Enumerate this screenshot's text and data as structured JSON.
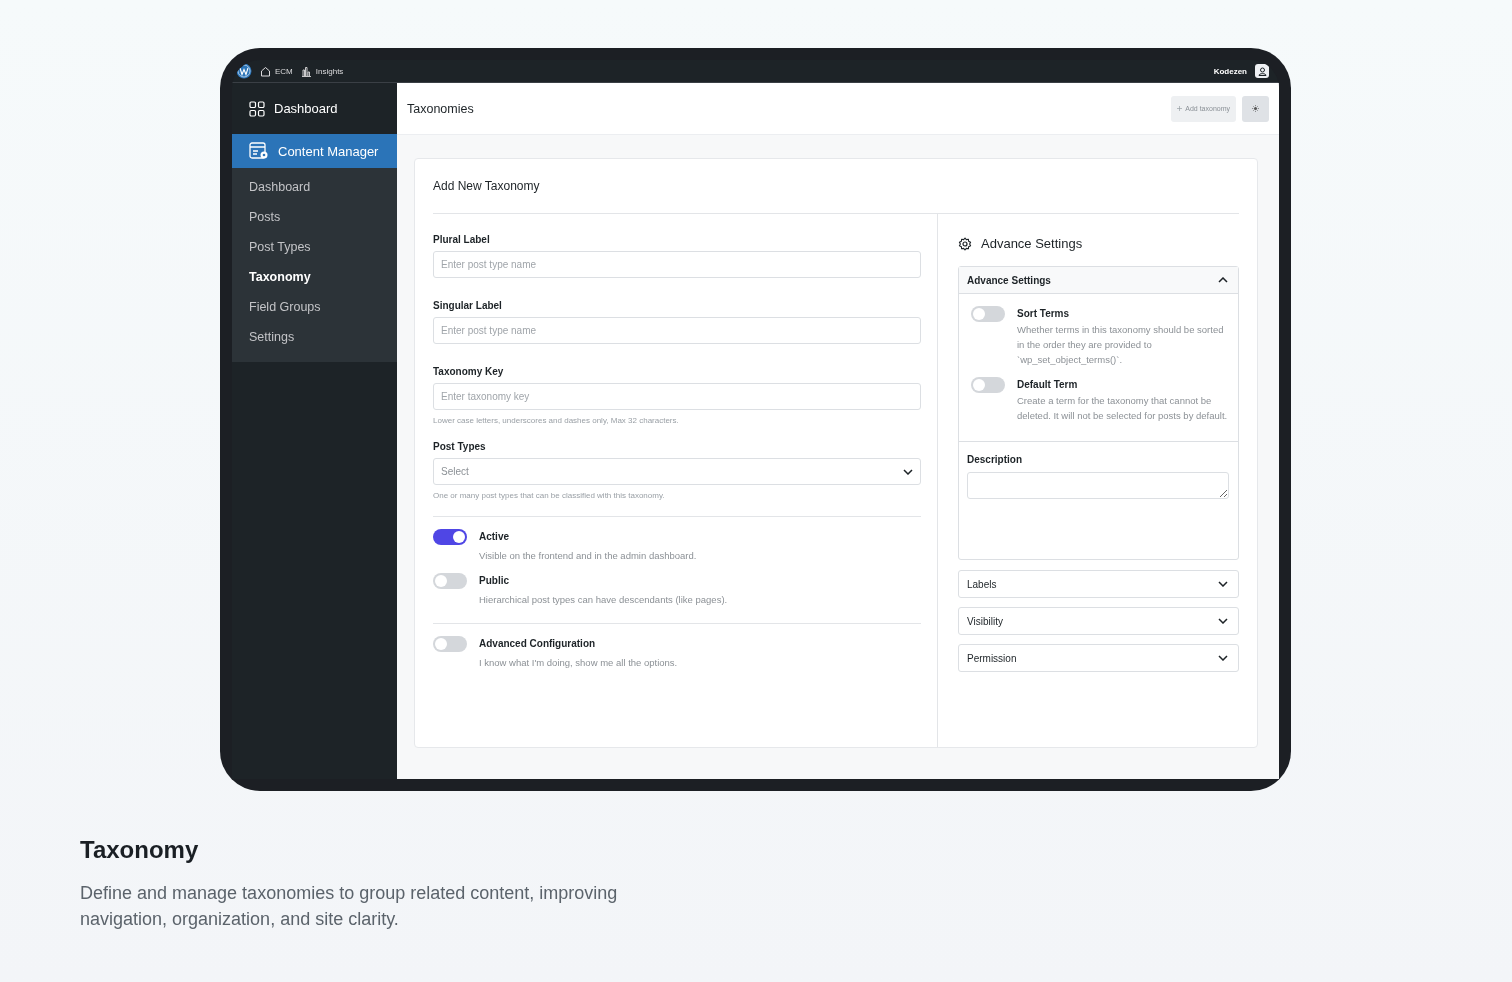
{
  "topbar": {
    "items": [
      {
        "kind": "home",
        "label": "ECM"
      },
      {
        "kind": "chart",
        "label": "Insights"
      }
    ],
    "user": "Kodezen"
  },
  "sidebar": {
    "header": "Dashboard",
    "section": {
      "label": "Content Manager",
      "selected": true
    },
    "items": [
      {
        "label": "Dashboard",
        "selected": false
      },
      {
        "label": "Posts",
        "selected": false
      },
      {
        "label": "Post Types",
        "selected": false
      },
      {
        "label": "Taxonomy",
        "selected": true
      },
      {
        "label": "Field Groups",
        "selected": false
      },
      {
        "label": "Settings",
        "selected": false
      }
    ]
  },
  "page": {
    "title": "Taxonomies",
    "add_button": "Add taxonomy"
  },
  "form": {
    "title": "Add New Taxonomy",
    "fields": [
      {
        "kind": "text",
        "label": "Plural Label",
        "placeholder": "Enter post type name"
      },
      {
        "kind": "text",
        "label": "Singular Label",
        "placeholder": "Enter post type name"
      },
      {
        "kind": "text",
        "label": "Taxonomy Key",
        "placeholder": "Enter taxonomy key",
        "help": "Lower case letters, underscores and dashes only, Max 32 characters."
      },
      {
        "kind": "select",
        "label": "Post Types",
        "placeholder": "Select",
        "help": "One or many post types that can be classified with this taxonomy."
      }
    ],
    "toggle_groups": [
      [
        {
          "title": "Active",
          "description": "Visible on the frontend and in the admin dashboard.",
          "on": true
        },
        {
          "title": "Public",
          "description": "Hierarchical post types can have descendants (like pages).",
          "on": false
        }
      ],
      [
        {
          "title": "Advanced Configuration",
          "description": "I know what I'm doing, show me all the options.",
          "on": false
        }
      ]
    ]
  },
  "advanced": {
    "title": "Advance Settings",
    "panel": {
      "title": "Advance Settings",
      "expanded": true,
      "toggles": [
        {
          "title": "Sort Terms",
          "description": "Whether terms in this taxonomy should be sorted in the order they are provided to `wp_set_object_terms()`.",
          "on": false
        },
        {
          "title": "Default Term",
          "description": "Create a term for the taxonomy that cannot be deleted. It will not be selected for posts by default.",
          "on": false
        }
      ],
      "description_label": "Description"
    },
    "sections": [
      {
        "label": "Labels",
        "expanded": false
      },
      {
        "label": "Visibility",
        "expanded": false
      },
      {
        "label": "Permission",
        "expanded": false
      }
    ]
  },
  "caption": {
    "title": "Taxonomy",
    "text": "Define and manage taxonomies to group related content, improving navigation, organization, and site clarity."
  }
}
